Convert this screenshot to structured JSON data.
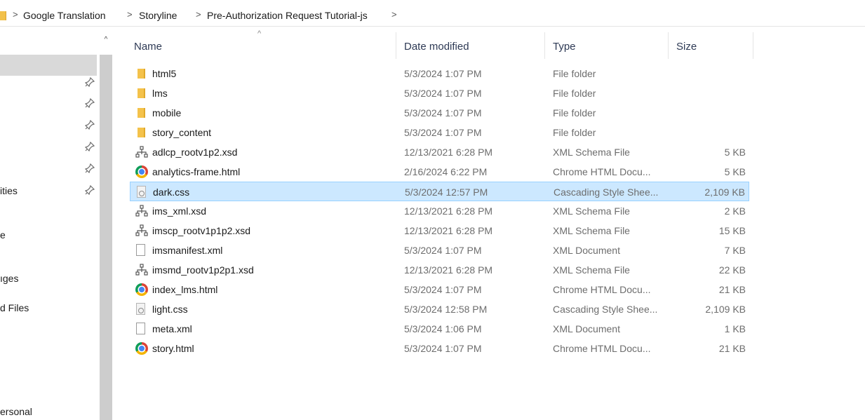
{
  "breadcrumb": {
    "items": [
      "Google Translation",
      "Storyline",
      "Pre-Authorization Request Tutorial-js"
    ],
    "separator": ">"
  },
  "nav": {
    "labels": [
      "ities",
      "e",
      "ıges",
      "d Files",
      "ersonal"
    ],
    "scroll_up_glyph": "^"
  },
  "columns": {
    "name": "Name",
    "date": "Date modified",
    "type": "Type",
    "size": "Size",
    "sort_indicator": "^"
  },
  "files": [
    {
      "name": "html5",
      "date": "5/3/2024 1:07 PM",
      "type": "File folder",
      "size": "",
      "icon": "folder-icon"
    },
    {
      "name": "lms",
      "date": "5/3/2024 1:07 PM",
      "type": "File folder",
      "size": "",
      "icon": "folder-icon"
    },
    {
      "name": "mobile",
      "date": "5/3/2024 1:07 PM",
      "type": "File folder",
      "size": "",
      "icon": "folder-icon"
    },
    {
      "name": "story_content",
      "date": "5/3/2024 1:07 PM",
      "type": "File folder",
      "size": "",
      "icon": "folder-icon"
    },
    {
      "name": "adlcp_rootv1p2.xsd",
      "date": "12/13/2021 6:28 PM",
      "type": "XML Schema File",
      "size": "5 KB",
      "icon": "xml-schema-icon"
    },
    {
      "name": "analytics-frame.html",
      "date": "2/16/2024 6:22 PM",
      "type": "Chrome HTML Docu...",
      "size": "5 KB",
      "icon": "chrome-icon"
    },
    {
      "name": "dark.css",
      "date": "5/3/2024 12:57 PM",
      "type": "Cascading Style Shee...",
      "size": "2,109 KB",
      "icon": "css-file-icon",
      "selected": true
    },
    {
      "name": "ims_xml.xsd",
      "date": "12/13/2021 6:28 PM",
      "type": "XML Schema File",
      "size": "2 KB",
      "icon": "xml-schema-icon"
    },
    {
      "name": "imscp_rootv1p1p2.xsd",
      "date": "12/13/2021 6:28 PM",
      "type": "XML Schema File",
      "size": "15 KB",
      "icon": "xml-schema-icon"
    },
    {
      "name": "imsmanifest.xml",
      "date": "5/3/2024 1:07 PM",
      "type": "XML Document",
      "size": "7 KB",
      "icon": "document-icon"
    },
    {
      "name": "imsmd_rootv1p2p1.xsd",
      "date": "12/13/2021 6:28 PM",
      "type": "XML Schema File",
      "size": "22 KB",
      "icon": "xml-schema-icon"
    },
    {
      "name": "index_lms.html",
      "date": "5/3/2024 1:07 PM",
      "type": "Chrome HTML Docu...",
      "size": "21 KB",
      "icon": "chrome-icon"
    },
    {
      "name": "light.css",
      "date": "5/3/2024 12:58 PM",
      "type": "Cascading Style Shee...",
      "size": "2,109 KB",
      "icon": "css-file-icon"
    },
    {
      "name": "meta.xml",
      "date": "5/3/2024 1:06 PM",
      "type": "XML Document",
      "size": "1 KB",
      "icon": "document-icon"
    },
    {
      "name": "story.html",
      "date": "5/3/2024 1:07 PM",
      "type": "Chrome HTML Docu...",
      "size": "21 KB",
      "icon": "chrome-icon"
    }
  ]
}
